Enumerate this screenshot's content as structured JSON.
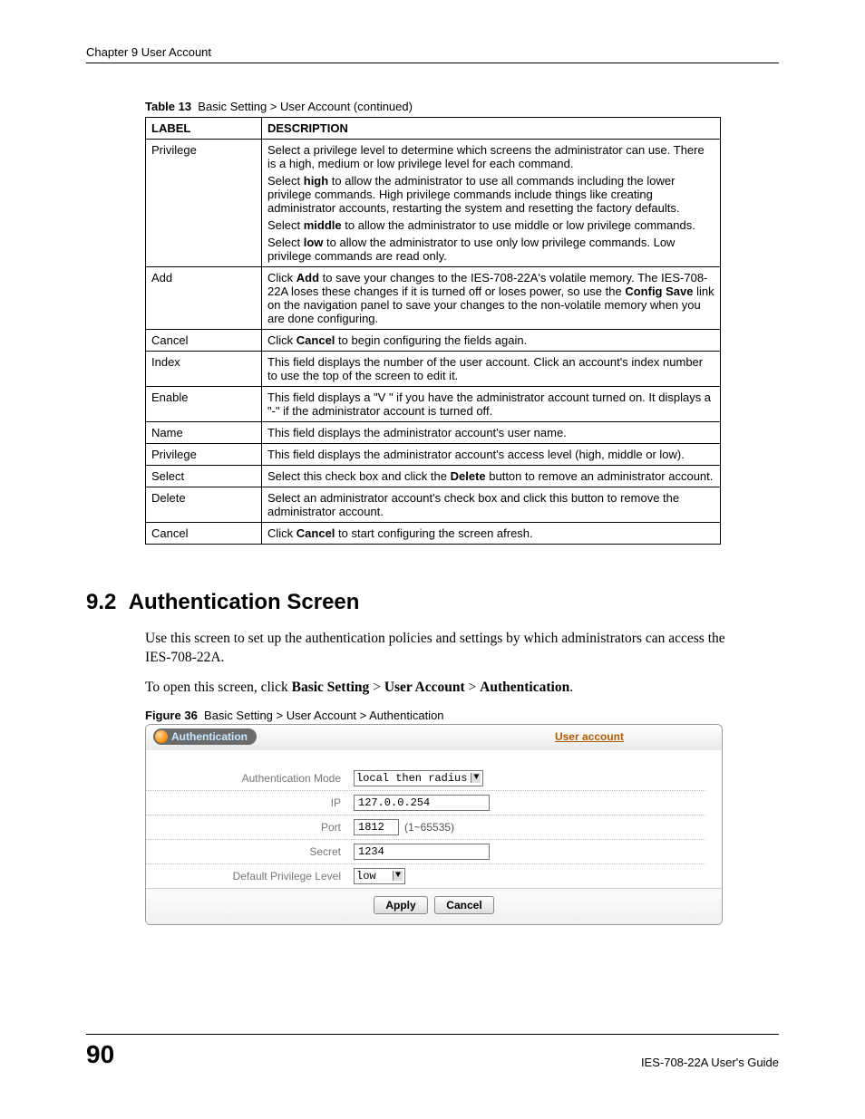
{
  "header": {
    "chapter": "Chapter 9 User Account"
  },
  "table": {
    "caption_label": "Table 13",
    "caption_text": "Basic Setting > User Account (continued)",
    "head": {
      "col1": "LABEL",
      "col2": "DESCRIPTION"
    },
    "rows": {
      "privilege": {
        "label": "Privilege",
        "p1": "Select a privilege level to determine which screens the administrator can use. There is a high, medium or low privilege level for each command.",
        "p2a": "Select ",
        "p2b": "high",
        "p2c": " to allow the administrator to use all commands including the lower privilege commands. High privilege commands include things like creating administrator accounts, restarting the system and resetting the factory defaults.",
        "p3a": "Select ",
        "p3b": "middle",
        "p3c": " to allow the administrator to use middle or low privilege commands.",
        "p4a": "Select ",
        "p4b": "low",
        "p4c": " to allow the administrator to use only low privilege commands. Low privilege commands are read only."
      },
      "add": {
        "label": "Add",
        "p1a": "Click ",
        "p1b": "Add",
        "p1c": " to save your changes to the IES-708-22A's volatile memory. The IES-708-22A loses these changes if it is turned off or loses power, so use the ",
        "p1d": "Config Save",
        "p1e": " link on the navigation panel to save your changes to the non-volatile memory when you are done configuring."
      },
      "cancel1": {
        "label": "Cancel",
        "p1a": "Click ",
        "p1b": "Cancel",
        "p1c": " to begin configuring the fields again."
      },
      "index": {
        "label": "Index",
        "p1": "This field displays the number of the user account. Click an account's index number to use the top of the screen to edit it."
      },
      "enable": {
        "label": "Enable",
        "p1": "This field displays a \"V \" if you have the administrator account turned on. It displays a \"-\" if the administrator account is turned off."
      },
      "name": {
        "label": "Name",
        "p1": "This field displays the administrator account's user name."
      },
      "privilege2": {
        "label": "Privilege",
        "p1": "This field displays the administrator account's access level (high, middle or low)."
      },
      "select": {
        "label": "Select",
        "p1a": "Select this check box and click the ",
        "p1b": "Delete",
        "p1c": " button to remove an administrator account."
      },
      "delete": {
        "label": "Delete",
        "p1": "Select an administrator account's check box and click this button to remove the administrator account."
      },
      "cancel2": {
        "label": "Cancel",
        "p1a": "Click ",
        "p1b": "Cancel",
        "p1c": " to start configuring the screen afresh."
      }
    }
  },
  "section": {
    "number": "9.2",
    "title": "Authentication Screen",
    "intro": "Use this screen to set up the authentication policies and settings by which administrators can access the IES-708-22A.",
    "nav_a": "To open this screen, click ",
    "nav_b": "Basic Setting",
    "nav_c": " > ",
    "nav_d": "User Account",
    "nav_e": " > ",
    "nav_f": "Authentication",
    "nav_g": "."
  },
  "figure": {
    "caption_label": "Figure 36",
    "caption_text": "Basic Setting > User Account > Authentication",
    "panel_title": "Authentication",
    "link": "User account",
    "rows": {
      "mode": {
        "label": "Authentication Mode",
        "value": "local then radius"
      },
      "ip": {
        "label": "IP",
        "value": "127.0.0.254"
      },
      "port": {
        "label": "Port",
        "value": "1812",
        "hint": "(1~65535)"
      },
      "secret": {
        "label": "Secret",
        "value": "1234"
      },
      "priv": {
        "label": "Default Privilege Level",
        "value": "low"
      }
    },
    "buttons": {
      "apply": "Apply",
      "cancel": "Cancel"
    }
  },
  "footer": {
    "page": "90",
    "guide": "IES-708-22A User's Guide"
  }
}
